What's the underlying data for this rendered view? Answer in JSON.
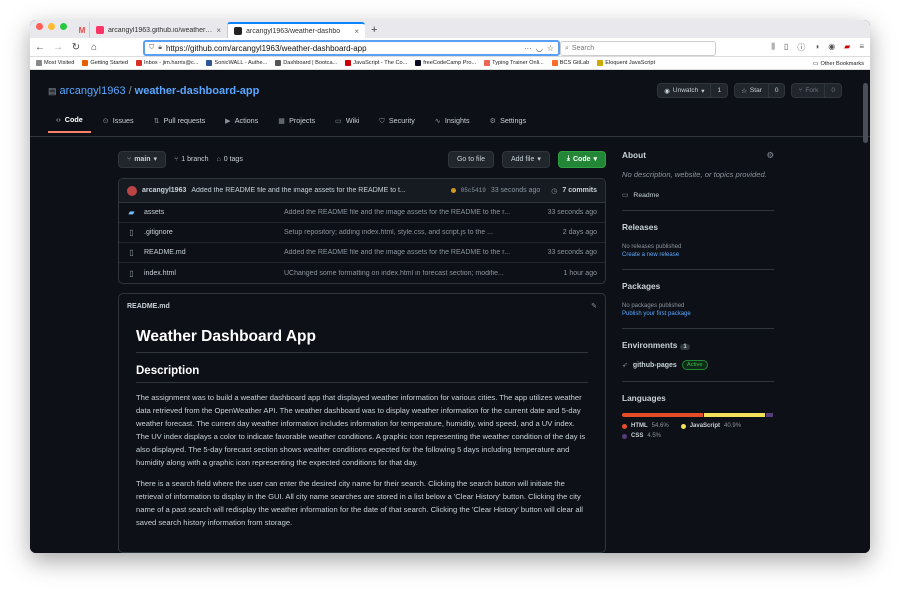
{
  "browser": {
    "tabs": [
      {
        "title": "arcangyl1963.github.io/weather-da",
        "fav_color": "#f36",
        "active": false
      },
      {
        "title": "arcangyl1963/weather-dashbo",
        "fav_color": "#222",
        "active": true
      }
    ],
    "url": "https://github.com/arcangyl1963/weather-dashboard-app",
    "search_placeholder": "Search",
    "bookmarks": [
      {
        "label": "Most Visited",
        "color": "#888"
      },
      {
        "label": "Getting Started",
        "color": "#e66000"
      },
      {
        "label": "Inbox - jim.harris@c...",
        "color": "#d93025"
      },
      {
        "label": "SonicWALL - Authe...",
        "color": "#2b5797"
      },
      {
        "label": "Dashboard | Bootca...",
        "color": "#555"
      },
      {
        "label": "JavaScript - The Co...",
        "color": "#c00"
      },
      {
        "label": "freeCodeCamp Pro...",
        "color": "#0a0a23"
      },
      {
        "label": "Typing Trainer Onli...",
        "color": "#e65"
      },
      {
        "label": "BCS GitLab",
        "color": "#fc6d26"
      },
      {
        "label": "Eloquent JavaScript",
        "color": "#ccaa00"
      }
    ],
    "other_bookmarks": "Other Bookmarks"
  },
  "repo": {
    "owner": "arcangyl1963",
    "sep": "/",
    "name": "weather-dashboard-app",
    "unwatch_label": "Unwatch",
    "unwatch_count": "1",
    "star_label": "Star",
    "star_count": "0",
    "fork_label": "Fork",
    "fork_count": "0",
    "nav": [
      {
        "label": "Code",
        "icon": "‹›"
      },
      {
        "label": "Issues",
        "icon": "⊙"
      },
      {
        "label": "Pull requests",
        "icon": "⇅"
      },
      {
        "label": "Actions",
        "icon": "▶"
      },
      {
        "label": "Projects",
        "icon": "▦"
      },
      {
        "label": "Wiki",
        "icon": "▭"
      },
      {
        "label": "Security",
        "icon": "⛉"
      },
      {
        "label": "Insights",
        "icon": "∿"
      },
      {
        "label": "Settings",
        "icon": "⚙"
      }
    ]
  },
  "toolbar": {
    "branch": "main",
    "branches": "1 branch",
    "tags": "0 tags",
    "goto_file": "Go to file",
    "add_file": "Add file",
    "code": "Code"
  },
  "commit": {
    "author": "arcangyl1963",
    "message": "Added the README file and the image assets for the README to t...",
    "hash": "05c5419",
    "time": "33 seconds ago",
    "count": "7 commits"
  },
  "files": [
    {
      "name": "assets",
      "type": "dir",
      "message": "Added the README file and the image assets for the README to the r...",
      "time": "33 seconds ago"
    },
    {
      "name": ".gitignore",
      "type": "file",
      "message": "Setup repository; adding index.html, style.css, and script.js to the ...",
      "time": "2 days ago"
    },
    {
      "name": "README.md",
      "type": "file",
      "message": "Added the README file and the image assets for the README to the r...",
      "time": "33 seconds ago"
    },
    {
      "name": "index.html",
      "type": "file",
      "message": "UChanged some formatting on index.html in forecast section; modifie...",
      "time": "1 hour ago"
    }
  ],
  "readme": {
    "filename": "README.md",
    "title": "Weather Dashboard App",
    "section": "Description",
    "p1": "The assignment was to build a weather dashboard app that displayed weather information for various cities. The app utilizes weather data retrieved from the OpenWeather API. The weather dashboard was to display weather information for the current date and 5-day weather forecast. The current day weather information includes information for temperature, humidity, wind speed, and a UV index. The UV index displays a color to indicate favorable weather conditions. A graphic icon representing the weather condition of the day is also displayed. The 5-day forecast section shows weather conditions expected for the following 5 days including temperature and humidity along with a graphic icon representing the expected conditions for that day.",
    "p2": "There is a search field where the user can enter the desired city name for their search. Clicking the search button will initiate the retrieval of information to display in the GUI. All city name searches are stored in a list below a 'Clear History' button. Clicking the city name of a past search will redisplay the weather information for the date of that search. Clicking the 'Clear History' button will clear all saved search history information from storage."
  },
  "sidebar": {
    "about_title": "About",
    "about_desc": "No description, website, or topics provided.",
    "readme_link": "Readme",
    "releases_title": "Releases",
    "releases_none": "No releases published",
    "releases_link": "Create a new release",
    "packages_title": "Packages",
    "packages_none": "No packages published",
    "packages_link": "Publish your first package",
    "env_title": "Environments",
    "env_count": "1",
    "env_name": "github-pages",
    "env_status": "Active",
    "lang_title": "Languages",
    "languages": [
      {
        "name": "HTML",
        "pct": "54.6%",
        "value": 54.6,
        "color": "#e34c26"
      },
      {
        "name": "JavaScript",
        "pct": "40.9%",
        "value": 40.9,
        "color": "#f1e05a"
      },
      {
        "name": "CSS",
        "pct": "4.5%",
        "value": 4.5,
        "color": "#563d7c"
      }
    ]
  }
}
